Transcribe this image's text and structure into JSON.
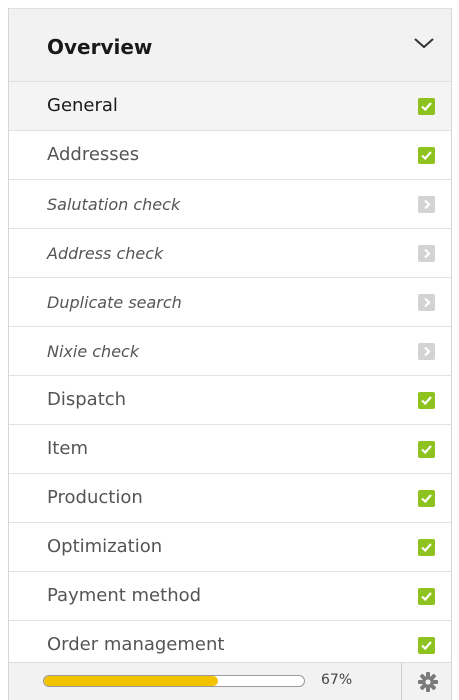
{
  "header": {
    "title": "Overview",
    "toggle_icon": "chevron-down-icon"
  },
  "items": [
    {
      "label": "General",
      "status": "complete",
      "status_icon": "checkmark-icon",
      "active": true,
      "italic": false
    },
    {
      "label": "Addresses",
      "status": "complete",
      "status_icon": "checkmark-icon",
      "active": false,
      "italic": false
    },
    {
      "label": "Salutation check",
      "status": "pending",
      "status_icon": "chevron-right-icon",
      "active": false,
      "italic": true
    },
    {
      "label": "Address check",
      "status": "pending",
      "status_icon": "chevron-right-icon",
      "active": false,
      "italic": true
    },
    {
      "label": "Duplicate search",
      "status": "pending",
      "status_icon": "chevron-right-icon",
      "active": false,
      "italic": true
    },
    {
      "label": "Nixie check",
      "status": "pending",
      "status_icon": "chevron-right-icon",
      "active": false,
      "italic": true
    },
    {
      "label": "Dispatch",
      "status": "complete",
      "status_icon": "checkmark-icon",
      "active": false,
      "italic": false
    },
    {
      "label": "Item",
      "status": "complete",
      "status_icon": "checkmark-icon",
      "active": false,
      "italic": false
    },
    {
      "label": "Production",
      "status": "complete",
      "status_icon": "checkmark-icon",
      "active": false,
      "italic": false
    },
    {
      "label": "Optimization",
      "status": "complete",
      "status_icon": "checkmark-icon",
      "active": false,
      "italic": false
    },
    {
      "label": "Payment method",
      "status": "complete",
      "status_icon": "checkmark-icon",
      "active": false,
      "italic": false
    },
    {
      "label": "Order management",
      "status": "complete",
      "status_icon": "checkmark-icon",
      "active": false,
      "italic": false
    }
  ],
  "footer": {
    "progress_value": 0.67,
    "progress_text": "67%",
    "settings_icon": "gear-icon"
  },
  "colors": {
    "check": "#8dc21f",
    "pending": "#d3d3d3",
    "progress_fill": "#f3c300"
  }
}
